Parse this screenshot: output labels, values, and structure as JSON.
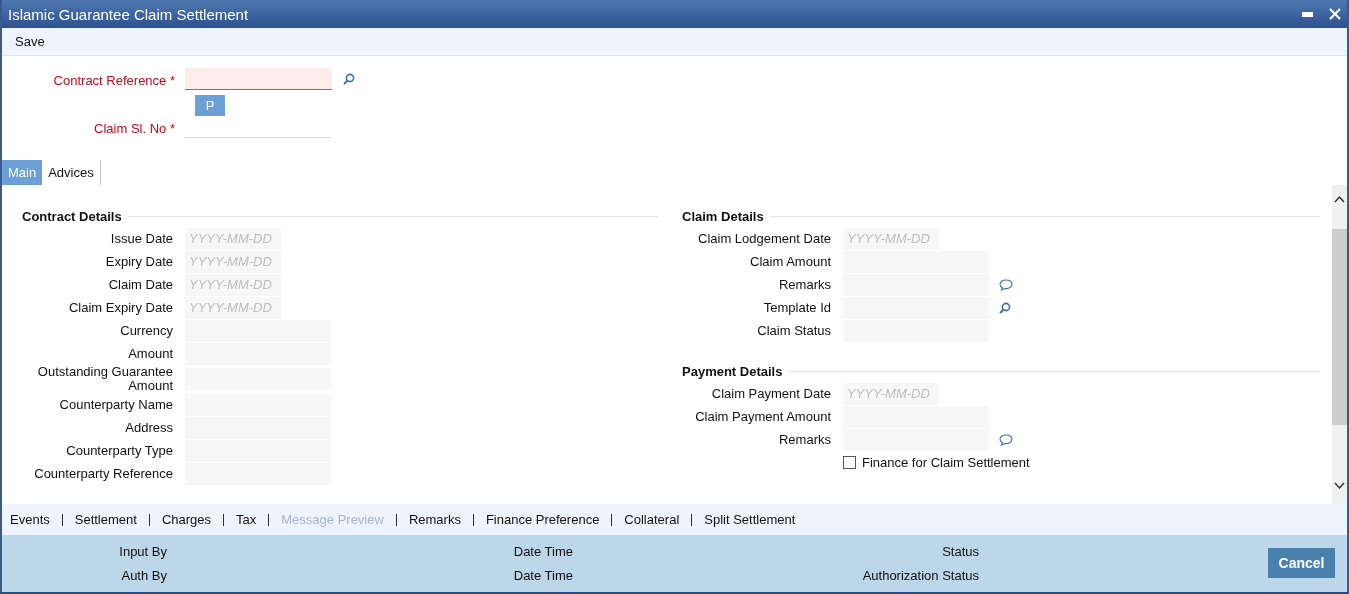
{
  "window": {
    "title": "Islamic Guarantee Claim Settlement"
  },
  "toolbar": [
    "Save"
  ],
  "header": {
    "contract_reference": {
      "label": "Contract Reference *",
      "focused": true
    },
    "p_button": "P",
    "claim_sl_no": {
      "label": "Claim Sl. No *",
      "focused": false
    }
  },
  "tabs": [
    {
      "label": "Main",
      "selected": true
    },
    {
      "label": "Advices",
      "selected": false
    }
  ],
  "panels": [
    {
      "sections": [
        {
          "title": "Contract Details",
          "fields": [
            {
              "label": "Issue Date",
              "kind": "date",
              "placeholder": "YYYY-MM-DD"
            },
            {
              "label": "Expiry Date",
              "kind": "date",
              "placeholder": "YYYY-MM-DD"
            },
            {
              "label": "Claim Date",
              "kind": "date",
              "placeholder": "YYYY-MM-DD"
            },
            {
              "label": "Claim Expiry Date",
              "kind": "date",
              "placeholder": "YYYY-MM-DD"
            },
            {
              "label": "Currency",
              "kind": "text"
            },
            {
              "label": "Amount",
              "kind": "text"
            },
            {
              "label": "Outstanding Guarantee Amount",
              "kind": "text"
            },
            {
              "label": "Counterparty Name",
              "kind": "text"
            },
            {
              "label": "Address",
              "kind": "text"
            },
            {
              "label": "Counterparty Type",
              "kind": "text"
            },
            {
              "label": "Counterparty Reference",
              "kind": "text"
            }
          ]
        }
      ]
    },
    {
      "sections": [
        {
          "title": "Claim Details",
          "fields": [
            {
              "label": "Claim Lodgement Date",
              "kind": "date",
              "placeholder": "YYYY-MM-DD"
            },
            {
              "label": "Claim Amount",
              "kind": "text"
            },
            {
              "label": "Remarks",
              "kind": "text_comment"
            },
            {
              "label": "Template Id",
              "kind": "text_lookup"
            },
            {
              "label": "Claim Status",
              "kind": "text"
            }
          ]
        },
        {
          "title": "Payment Details",
          "fields": [
            {
              "label": "Claim Payment Date",
              "kind": "date",
              "placeholder": "YYYY-MM-DD"
            },
            {
              "label": "Claim Payment Amount",
              "kind": "text"
            },
            {
              "label": "Remarks",
              "kind": "text_comment"
            },
            {
              "label": "Finance for Claim Settlement",
              "kind": "checkbox",
              "checked": false
            }
          ]
        }
      ]
    }
  ],
  "links": [
    {
      "label": "Events",
      "disabled": false
    },
    {
      "label": "Settlement",
      "disabled": false
    },
    {
      "label": "Charges",
      "disabled": false
    },
    {
      "label": "Tax",
      "disabled": false
    },
    {
      "label": "Message Preview",
      "disabled": true
    },
    {
      "label": "Remarks",
      "disabled": false
    },
    {
      "label": "Finance Preference",
      "disabled": false
    },
    {
      "label": "Collateral",
      "disabled": false
    },
    {
      "label": "Split Settlement",
      "disabled": false
    }
  ],
  "audit": [
    {
      "label": "Input By"
    },
    {
      "label": "Date Time"
    },
    {
      "label": "Status"
    },
    {
      "label": "Auth By"
    },
    {
      "label": "Date Time"
    },
    {
      "label": "Authorization Status"
    }
  ],
  "buttons": [
    "Cancel"
  ]
}
